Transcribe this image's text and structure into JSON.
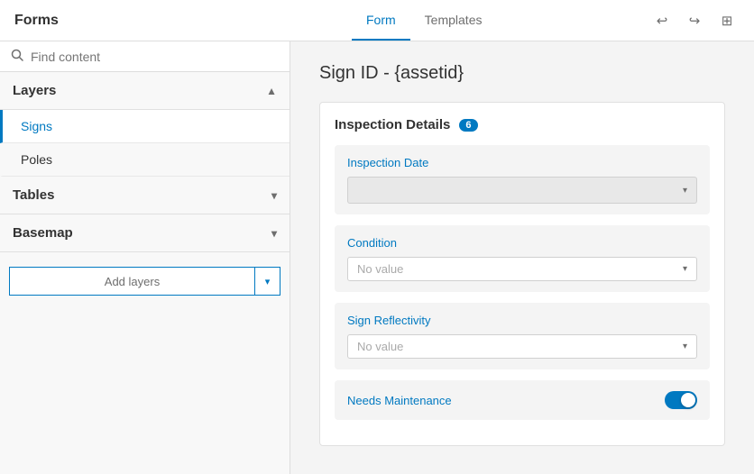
{
  "header": {
    "title": "Forms",
    "tabs": [
      {
        "label": "Form",
        "active": true
      },
      {
        "label": "Templates",
        "active": false
      }
    ],
    "actions": {
      "undo_icon": "↩",
      "redo_icon": "↪",
      "grid_icon": "⊞"
    }
  },
  "sidebar": {
    "search_placeholder": "Find content",
    "sections": [
      {
        "label": "Layers",
        "expanded": true,
        "items": [
          {
            "label": "Signs",
            "active": true
          },
          {
            "label": "Poles",
            "active": false
          }
        ]
      },
      {
        "label": "Tables",
        "expanded": false,
        "items": []
      },
      {
        "label": "Basemap",
        "expanded": false,
        "items": []
      }
    ],
    "add_layers_label": "Add layers",
    "add_layers_dropdown_icon": "▾"
  },
  "content": {
    "page_title": "Sign ID - {assetid}",
    "section_title": "Inspection Details",
    "section_badge": "6",
    "fields": [
      {
        "label": "Inspection Date",
        "type": "date",
        "value": "",
        "placeholder": ""
      },
      {
        "label": "Condition",
        "type": "select",
        "value": "No value",
        "placeholder": "No value"
      },
      {
        "label": "Sign Reflectivity",
        "type": "select",
        "value": "No value",
        "placeholder": "No value"
      },
      {
        "label": "Needs Maintenance",
        "type": "toggle",
        "value": true
      }
    ]
  }
}
